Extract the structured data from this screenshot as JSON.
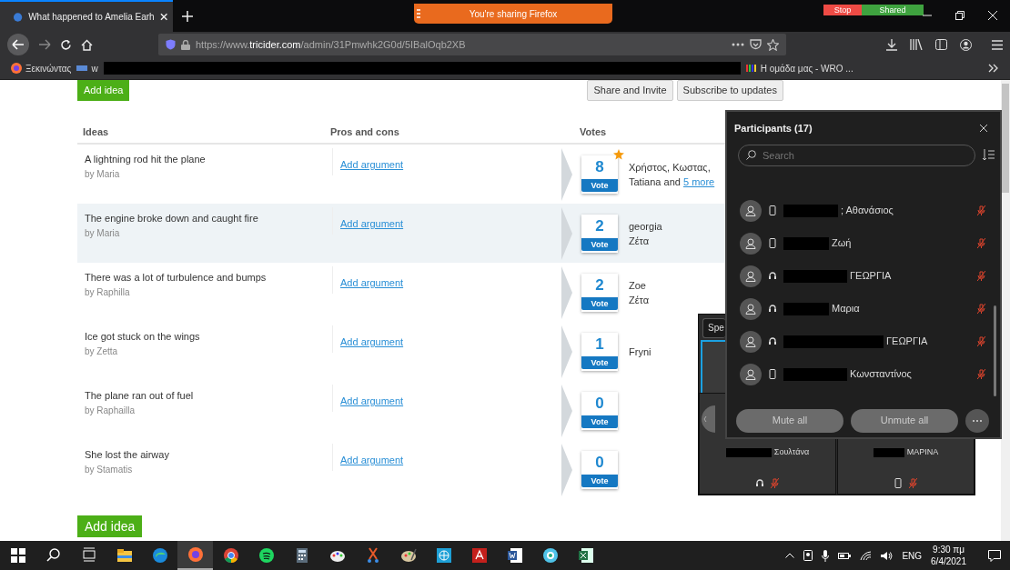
{
  "browser": {
    "tab_title": "What happened to Amelia Earh",
    "sharing_banner": "You're sharing Firefox",
    "stop_button": "Stop",
    "shared_label": "Shared",
    "url_prefix": "https://www.",
    "url_host": "tricider.com",
    "url_path": "/admin/31Pmwhk2G0d/5IBalOqb2XB",
    "bookmarks": [
      {
        "label": "Ξεκινώντας",
        "kind": "firefox"
      },
      {
        "label": "w",
        "kind": "site"
      },
      {
        "label": "Η ομάδα μας - WRO ...",
        "kind": "bars"
      }
    ]
  },
  "page": {
    "add_idea_top": "Add idea",
    "share_button": "Share and Invite",
    "subscribe_button": "Subscribe to updates",
    "add_idea_bottom": "Add idea",
    "columns": [
      "Ideas",
      "Pros and cons",
      "Votes"
    ],
    "ideas": [
      {
        "title": "A lightning rod hit the plane",
        "author": "by Maria",
        "argument_link": "Add argument",
        "votes": "8",
        "vote_label": "Vote",
        "starred": true,
        "highlighted": false,
        "voters": [
          "Χρήστος, Κωστας,",
          "Tatiana and"
        ],
        "more_link": "5 more"
      },
      {
        "title": "The engine broke down and caught fire",
        "author": "by Maria",
        "argument_link": "Add argument",
        "votes": "2",
        "vote_label": "Vote",
        "starred": false,
        "highlighted": true,
        "voters": [
          "georgia",
          "Ζέτα"
        ]
      },
      {
        "title": "There was a lot of turbulence and bumps",
        "author": "by Raphilla",
        "argument_link": "Add argument",
        "votes": "2",
        "vote_label": "Vote",
        "starred": false,
        "highlighted": false,
        "voters": [
          "Zoe",
          "Ζέτα"
        ]
      },
      {
        "title": "Ice got stuck on the wings",
        "author": "by Zetta",
        "argument_link": "Add argument",
        "votes": "1",
        "vote_label": "Vote",
        "starred": false,
        "highlighted": false,
        "voters": [
          "Fryni"
        ]
      },
      {
        "title": "The plane ran out of fuel",
        "author": "by Raphailla",
        "argument_link": "Add argument",
        "votes": "0",
        "vote_label": "Vote",
        "starred": false,
        "highlighted": false
      },
      {
        "title": "She lost the airway",
        "author": "by Stamatis",
        "argument_link": "Add argument",
        "votes": "0",
        "vote_label": "Vote",
        "starred": false,
        "highlighted": false
      }
    ]
  },
  "speaker_window": {
    "tab": "Spe",
    "tiles": [
      {
        "name": "Σουλτάνα",
        "kind": "headset",
        "muted": true,
        "redacted": true
      },
      {
        "name": "ΜΑΡΙΝΑ",
        "kind": "phone",
        "muted": true,
        "redacted": true
      }
    ]
  },
  "participants": {
    "title": "Participants (17)",
    "search": {
      "placeholder": "Search"
    },
    "rows": [
      {
        "name": "; Αθανάσιος",
        "kind": "phone",
        "muted": true,
        "redacted": true
      },
      {
        "name": "Ζωή",
        "kind": "phone",
        "muted": true,
        "redacted": true
      },
      {
        "name": "ΓΕΩΡΓΙΑ",
        "kind": "headset",
        "muted": true,
        "redacted": true
      },
      {
        "name": "Μαρια",
        "kind": "headset",
        "muted": true,
        "redacted": true
      },
      {
        "name": "ΓΕΩΡΓΙΑ",
        "kind": "headset",
        "muted": true,
        "redacted": true
      },
      {
        "name": "Κωνσταντίνος",
        "kind": "phone",
        "muted": true,
        "redacted": true
      }
    ],
    "mute_all": "Mute all",
    "unmute_all": "Unmute all"
  },
  "taskbar": {
    "apps": [
      {
        "kind": "explorer",
        "active": false
      },
      {
        "kind": "edge",
        "active": false
      },
      {
        "kind": "firefox",
        "active": true
      },
      {
        "kind": "chrome",
        "active": false
      },
      {
        "kind": "spotify",
        "active": false
      },
      {
        "kind": "calculator",
        "active": false
      },
      {
        "kind": "paint",
        "active": false
      },
      {
        "kind": "scissors",
        "active": false
      },
      {
        "kind": "palette",
        "active": false
      },
      {
        "kind": "globe",
        "active": false
      },
      {
        "kind": "pdf",
        "active": false
      },
      {
        "kind": "word",
        "active": false
      },
      {
        "kind": "disc",
        "active": false
      },
      {
        "kind": "excel",
        "active": false
      }
    ],
    "language": "ENG",
    "time": "9:30 πμ",
    "date": "6/4/2021"
  }
}
